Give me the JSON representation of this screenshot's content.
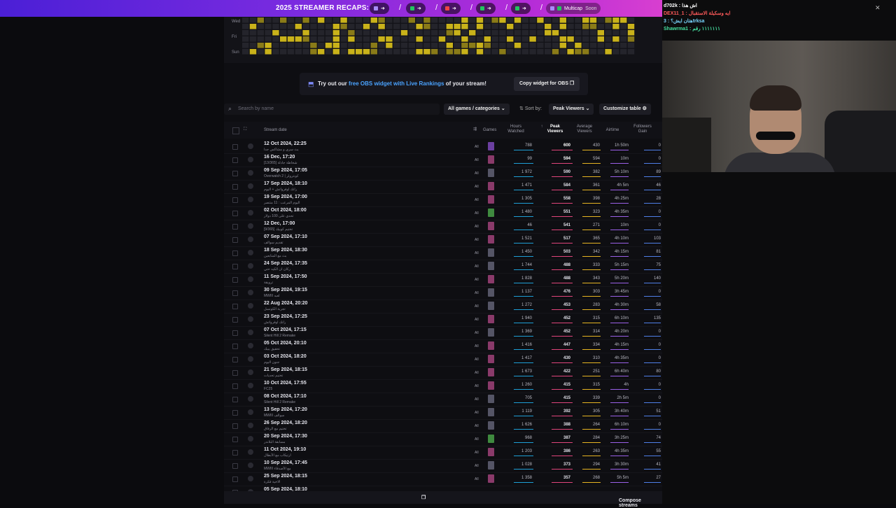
{
  "banner": {
    "title": "2025 STREAMER RECAPS:",
    "multicast": "Multicap",
    "soon": "Soon",
    "chips": [
      {
        "color": "#8b5cf6",
        "icon": "play-icon"
      },
      {
        "color": "#22c55e",
        "icon": "kick-icon"
      },
      {
        "color": "#ef4444",
        "icon": "record-icon"
      },
      {
        "color": "#22c55e",
        "icon": "bot-icon"
      },
      {
        "color": "#22c55e",
        "icon": "play-icon"
      }
    ]
  },
  "heatmap": {
    "days": [
      "Wed",
      "Fri",
      "Sun"
    ]
  },
  "obs": {
    "prefix": "Try out our ",
    "highlight": "free OBS widget with Live Rankings",
    "suffix": " of your stream!",
    "button": "Copy widget for OBS"
  },
  "toolbar": {
    "search_placeholder": "Search by name",
    "filter": "All games / categories",
    "sort_label": "Sort by:",
    "sort_value": "Peak Viewers",
    "customize": "Customize table"
  },
  "table": {
    "headers": {
      "date": "Stream date",
      "games": "Games",
      "hours": "Hours Watched",
      "peak": "Peak Viewers",
      "avg": "Average Viewers",
      "airtime": "Airtime",
      "followers": "Followers Gain"
    },
    "rows": [
      {
        "date": "12 Oct 2024, 22:25",
        "sub": "بث سري و مشاكس جدا",
        "game": "#6b3fa0",
        "hours": "788",
        "peak": "600",
        "avg": "430",
        "air": "1h 50m",
        "fol": "0"
      },
      {
        "date": "16 Dec, 17:20",
        "sub": "[13/365] شخاطة جادلة",
        "game": "#8a3a6a",
        "hours": "99",
        "peak": "594",
        "avg": "594",
        "air": "10m",
        "fol": "0"
      },
      {
        "date": "09 Sep 2024, 17:05",
        "sub": "Overwatch 2 | كونترولر",
        "game": "#555566",
        "hours": "1 972",
        "peak": "590",
        "avg": "382",
        "air": "5h 10m",
        "fol": "89"
      },
      {
        "date": "17 Sep 2024, 18:10",
        "sub": "رانك اوفرواتش + اليوم",
        "game": "#8a3a6a",
        "hours": "1 471",
        "peak": "584",
        "avg": "361",
        "air": "4h 5m",
        "fol": "46"
      },
      {
        "date": "19 Sep 2024, 17:00",
        "sub": "اليوم المرعب : 11 منتصر",
        "game": "#8a3a6a",
        "hours": "1 305",
        "peak": "558",
        "avg": "398",
        "air": "4h 25m",
        "fol": "28"
      },
      {
        "date": "02 Oct 2024, 18:00",
        "sub": "تحدي على 100 دولار",
        "game": "#3f8a3f",
        "hours": "1 480",
        "peak": "551",
        "avg": "323",
        "air": "4h 35m",
        "fol": "0"
      },
      {
        "date": "12 Dec, 17:00",
        "sub": "[9/365] تختيم كوبيك",
        "game": "#8a3a6a",
        "hours": "46",
        "peak": "541",
        "avg": "271",
        "air": "10m",
        "fol": "0"
      },
      {
        "date": "07 Sep 2024, 17:10",
        "sub": "تقديم سوالف",
        "game": "#8a3a6a",
        "hours": "1 521",
        "peak": "517",
        "avg": "365",
        "air": "4h 10m",
        "fol": "103"
      },
      {
        "date": "18 Sep 2024, 18:30",
        "sub": "بث مع المتابعين",
        "game": "#555566",
        "hours": "1 450",
        "peak": "503",
        "avg": "342",
        "air": "4h 15m",
        "fol": "81"
      },
      {
        "date": "24 Sep 2024, 17:35",
        "sub": "ركان ان الكيه حتي",
        "game": "#555566",
        "hours": "1 744",
        "peak": "488",
        "avg": "333",
        "air": "5h 15m",
        "fol": "75"
      },
      {
        "date": "11 Sep 2024, 17:50",
        "sub": "ترويقة",
        "game": "#8a3a6a",
        "hours": "1 828",
        "peak": "488",
        "avg": "343",
        "air": "5h 20m",
        "fol": "140"
      },
      {
        "date": "30 Sep 2024, 19:15",
        "sub": "MWIII لعبه",
        "game": "#555566",
        "hours": "1 137",
        "peak": "476",
        "avg": "303",
        "air": "3h 45m",
        "fol": "0"
      },
      {
        "date": "22 Aug 2024, 20:20",
        "sub": "تجربة الكونسل",
        "game": "#555566",
        "hours": "1 272",
        "peak": "453",
        "avg": "283",
        "air": "4h 30m",
        "fol": "58"
      },
      {
        "date": "23 Sep 2024, 17:25",
        "sub": "رانك اوفرواتش",
        "game": "#8a3a6a",
        "hours": "1 940",
        "peak": "452",
        "avg": "315",
        "air": "6h 10m",
        "fol": "135"
      },
      {
        "date": "07 Oct 2024, 17:15",
        "sub": "Silent Hill 2 Remake",
        "game": "#555566",
        "hours": "1 369",
        "peak": "452",
        "avg": "314",
        "air": "4h 20m",
        "fol": "0"
      },
      {
        "date": "05 Oct 2024, 20:10",
        "sub": "تحقيق يبيك",
        "game": "#8a3a6a",
        "hours": "1 416",
        "peak": "447",
        "avg": "334",
        "air": "4h 15m",
        "fol": "0"
      },
      {
        "date": "03 Oct 2024, 18:20",
        "sub": "جنون اليوم",
        "game": "#8a3a6a",
        "hours": "1 417",
        "peak": "430",
        "avg": "310",
        "air": "4h 35m",
        "fol": "0"
      },
      {
        "date": "21 Sep 2024, 18:15",
        "sub": "تختيم تحديات",
        "game": "#8a3a6a",
        "hours": "1 673",
        "peak": "422",
        "avg": "251",
        "air": "6h 40m",
        "fol": "80"
      },
      {
        "date": "10 Oct 2024, 17:55",
        "sub": "FC25",
        "game": "#8a3a6a",
        "hours": "1 260",
        "peak": "415",
        "avg": "315",
        "air": "4h",
        "fol": "0"
      },
      {
        "date": "08 Oct 2024, 17:10",
        "sub": "Silent Hill 2 Remake",
        "game": "#555566",
        "hours": "705",
        "peak": "415",
        "avg": "339",
        "air": "2h 5m",
        "fol": "0"
      },
      {
        "date": "13 Sep 2024, 17:20",
        "sub": "MWIII سوالف",
        "game": "#555566",
        "hours": "1 119",
        "peak": "392",
        "avg": "305",
        "air": "3h 40m",
        "fol": "51"
      },
      {
        "date": "26 Sep 2024, 18:20",
        "sub": "تختيم مع الرفاق",
        "game": "#555566",
        "hours": "1 626",
        "peak": "388",
        "avg": "264",
        "air": "6h 10m",
        "fol": "0"
      },
      {
        "date": "20 Sep 2024, 17:30",
        "sub": "مسابقة البلاندر",
        "game": "#3f8a3f",
        "hours": "968",
        "peak": "387",
        "avg": "284",
        "air": "3h 25m",
        "fol": "74"
      },
      {
        "date": "11 Oct 2024, 19:10",
        "sub": "ارتيكاب مع الأبطال",
        "game": "#8a3a6a",
        "hours": "1 203",
        "peak": "386",
        "avg": "263",
        "air": "4h 35m",
        "fol": "55"
      },
      {
        "date": "10 Sep 2024, 17:45",
        "sub": "MWIII مع الأصدقاء",
        "game": "#555566",
        "hours": "1 028",
        "peak": "373",
        "avg": "294",
        "air": "3h 30m",
        "fol": "41"
      },
      {
        "date": "25 Sep 2024, 18:15",
        "sub": "الاخية فكرة",
        "game": "#8a3a6a",
        "hours": "1 358",
        "peak": "357",
        "avg": "268",
        "air": "5h 5m",
        "fol": "27"
      },
      {
        "date": "05 Sep 2024, 18:10",
        "sub": "",
        "game": "#8a3a6a",
        "hours": "",
        "peak": "",
        "avg": "",
        "air": "",
        "fol": ""
      }
    ]
  },
  "compose": "Compose streams",
  "chat": [
    {
      "line": "d702k : اش هذا",
      "cls": "n1"
    },
    {
      "line": "DEX11_1 : ايه وسكيلة الاستقبال",
      "cls": "n2"
    },
    {
      "line": "هتان ايش؟ : 3trksa",
      "cls": "n3"
    },
    {
      "line": "Shawrma1 : ١١١١١١١ رقم",
      "cls": "n4"
    }
  ]
}
